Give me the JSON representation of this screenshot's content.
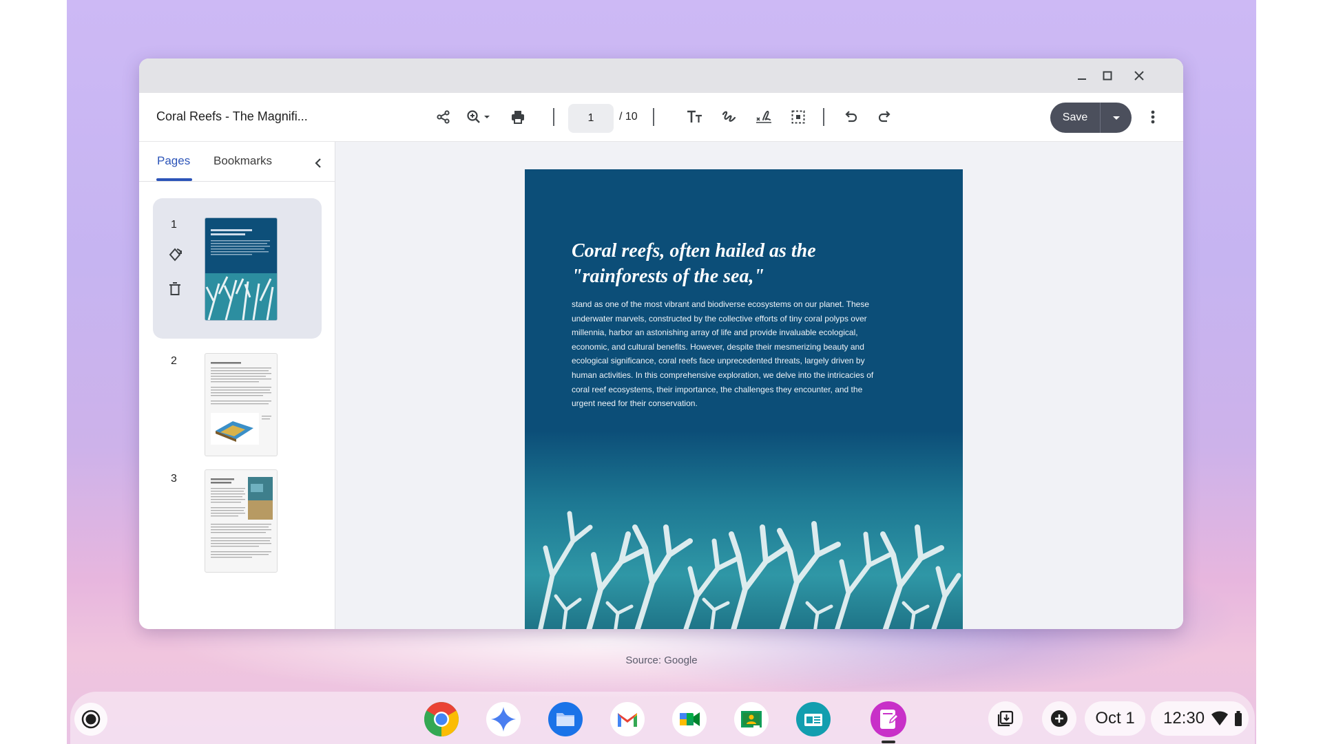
{
  "source_caption": "Source: Google",
  "window": {
    "controls": [
      "minimize",
      "maximize",
      "close"
    ]
  },
  "toolbar": {
    "doc_title": "Coral Reefs - The Magnifi...",
    "page_current": "1",
    "page_total": "/ 10",
    "save_label": "Save",
    "icons": [
      "share-icon",
      "zoom-in-icon",
      "print-icon",
      "text-icon",
      "draw-icon",
      "signature-icon",
      "select-area-icon",
      "undo-icon",
      "redo-icon",
      "more-vert-icon"
    ]
  },
  "sidebar": {
    "tabs": [
      {
        "label": "Pages",
        "active": true
      },
      {
        "label": "Bookmarks",
        "active": false
      }
    ],
    "pages": [
      {
        "number": "1",
        "selected": true
      },
      {
        "number": "2",
        "selected": false
      },
      {
        "number": "3",
        "selected": false
      }
    ]
  },
  "document": {
    "heading": "Coral reefs, often hailed as the \"rainforests of the sea,\"",
    "body": "stand as one of the most vibrant and biodiverse ecosystems on our planet. These underwater marvels, constructed by the collective efforts of tiny coral polyps over millennia, harbor an astonishing array of life and provide invaluable ecological, economic, and cultural benefits. However, despite their mesmerizing beauty and ecological significance, coral reefs face unprecedented threats, largely driven by human activities. In this comprehensive exploration, we delve into the intricacies of coral reef ecosystems, their importance, the challenges they encounter, and the urgent need for their conservation."
  },
  "shelf": {
    "launcher_icon": "launcher-icon",
    "apps": [
      "chrome-icon",
      "gemini-icon",
      "files-icon",
      "gmail-icon",
      "meet-icon",
      "classroom-icon",
      "app-icon",
      "pdf-editor-icon"
    ],
    "date": "Oct 1",
    "time": "12:30",
    "colors": {
      "chrome_red": "#ea4335",
      "chrome_yellow": "#fbbc04",
      "chrome_green": "#34a853",
      "blue": "#4285f4",
      "pdf_editor": "#c830c8"
    }
  }
}
